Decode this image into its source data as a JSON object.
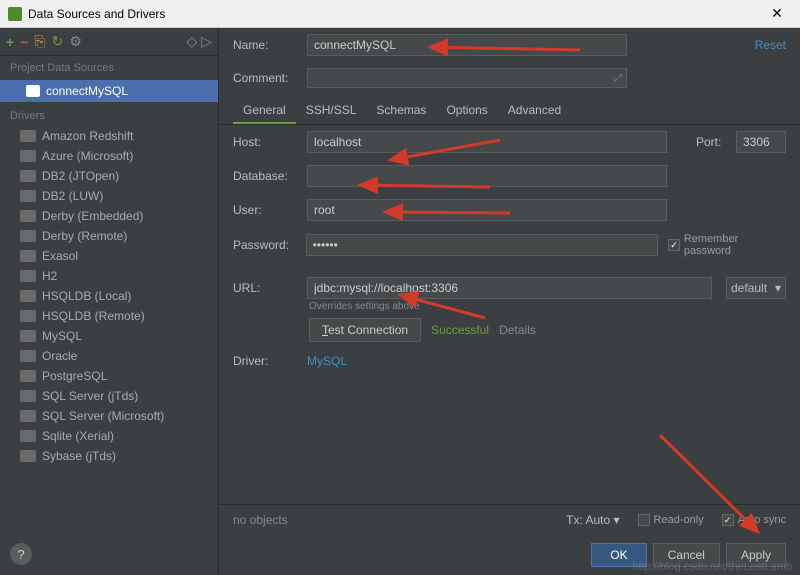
{
  "window": {
    "title": "Data Sources and Drivers"
  },
  "sidebar": {
    "projectHeader": "Project Data Sources",
    "dataSource": "connectMySQL",
    "driversHeader": "Drivers",
    "drivers": [
      "Amazon Redshift",
      "Azure (Microsoft)",
      "DB2 (JTOpen)",
      "DB2 (LUW)",
      "Derby (Embedded)",
      "Derby (Remote)",
      "Exasol",
      "H2",
      "HSQLDB (Local)",
      "HSQLDB (Remote)",
      "MySQL",
      "Oracle",
      "PostgreSQL",
      "SQL Server (jTds)",
      "SQL Server (Microsoft)",
      "Sqlite (Xerial)",
      "Sybase (jTds)"
    ]
  },
  "form": {
    "nameLabel": "Name:",
    "nameValue": "connectMySQL",
    "reset": "Reset",
    "commentLabel": "Comment:",
    "tabs": [
      "General",
      "SSH/SSL",
      "Schemas",
      "Options",
      "Advanced"
    ],
    "hostLabel": "Host:",
    "hostValue": "localhost",
    "portLabel": "Port:",
    "portValue": "3306",
    "dbLabel": "Database:",
    "dbValue": "",
    "userLabel": "User:",
    "userValue": "root",
    "pwdLabel": "Password:",
    "pwdValue": "••••••",
    "rememberPwd": "Remember password",
    "urlLabel": "URL:",
    "urlValue": "jdbc:mysql://localhost:3306",
    "urlMode": "default",
    "override": "Overrides settings above",
    "testBtn": "Test Connection",
    "testResult": "Successful",
    "details": "Details",
    "driverLabel": "Driver:",
    "driverLink": "MySQL"
  },
  "footer": {
    "noObjects": "no objects",
    "tx": "Tx: Auto",
    "readonly": "Read-only",
    "autosync": "Auto sync",
    "ok": "OK",
    "cancel": "Cancel",
    "apply": "Apply"
  },
  "watermark": "http://blog.csdn.net/theLostLamb"
}
